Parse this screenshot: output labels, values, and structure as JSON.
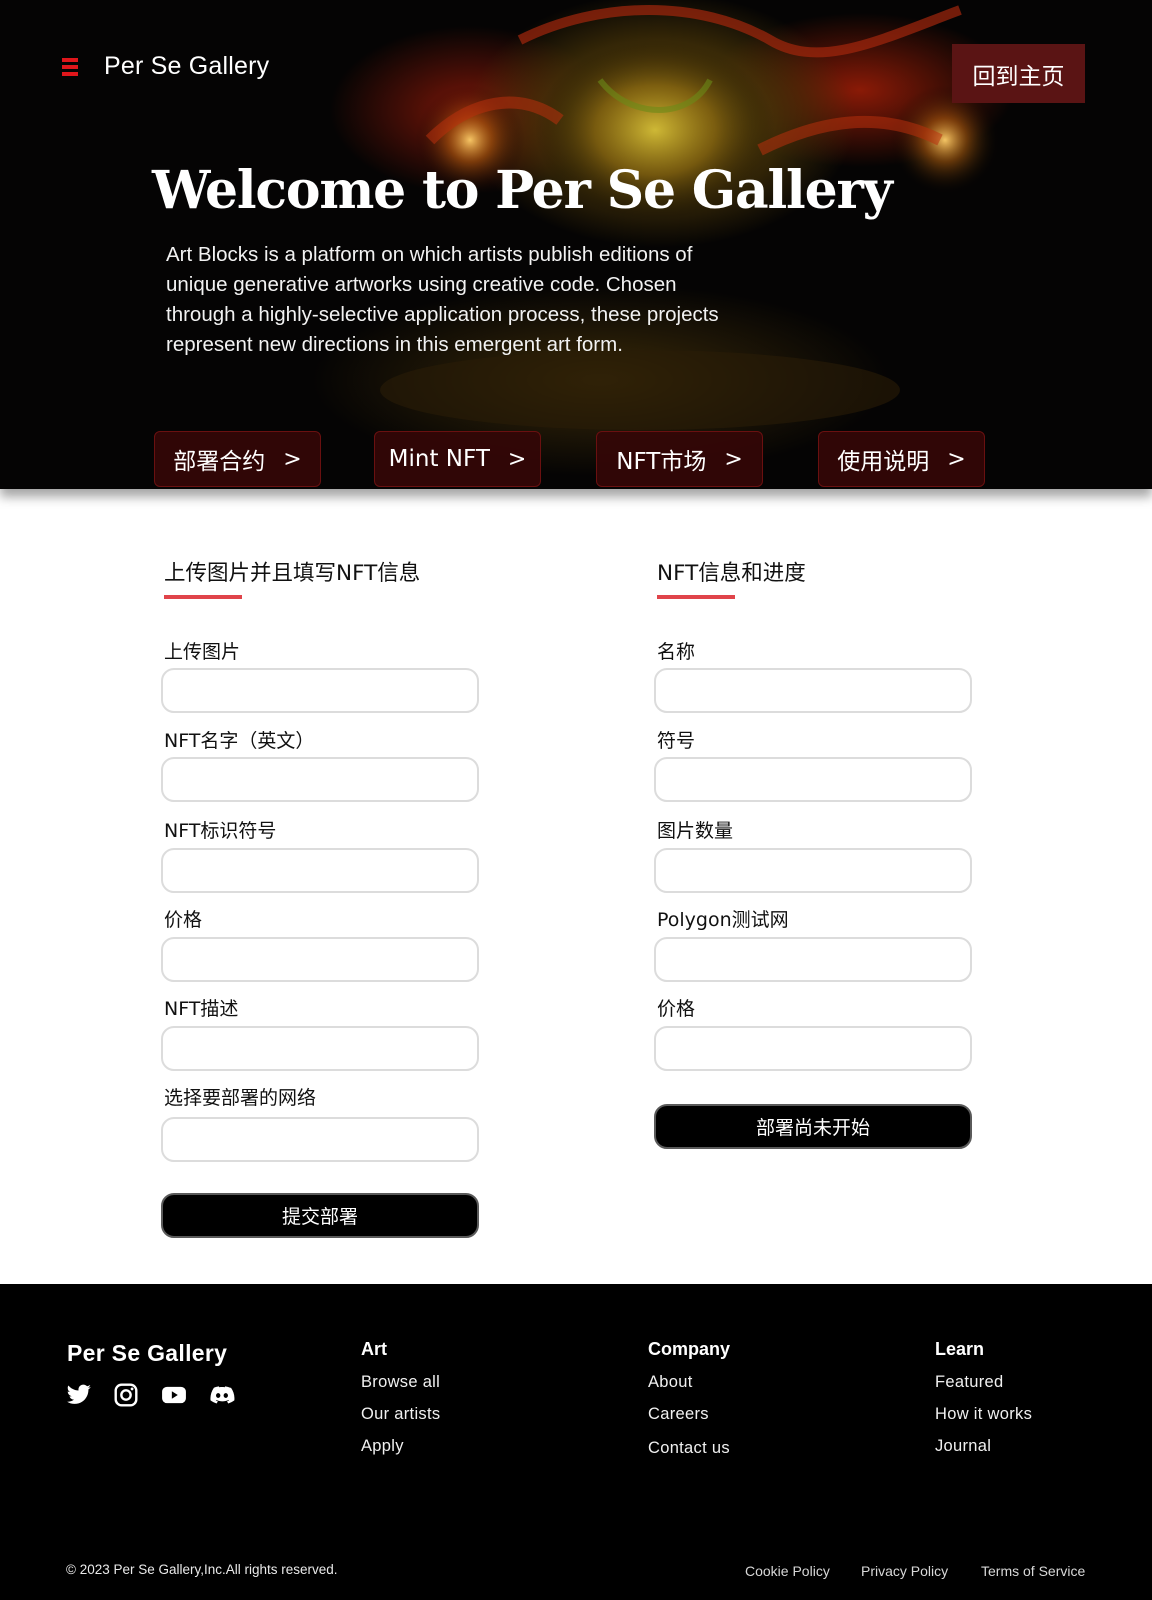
{
  "header": {
    "logo": "Per Se Gallery",
    "home_button": "回到主页"
  },
  "hero": {
    "title": "Welcome to Per Se Gallery",
    "description": "Art Blocks is a platform on which artists publish editions of unique generative artworks using creative code. Chosen through a highly-selective application process, these projects represent new directions in this emergent art form.",
    "buttons": [
      {
        "label": "部署合约"
      },
      {
        "label": "Mint NFT"
      },
      {
        "label": "NFT市场"
      },
      {
        "label": "使用说明"
      }
    ]
  },
  "upload_form": {
    "title": "上传图片并且填写NFT信息",
    "fields": [
      {
        "label": "上传图片",
        "value": ""
      },
      {
        "label": "NFT名字（英文）",
        "value": ""
      },
      {
        "label": "NFT标识符号",
        "value": ""
      },
      {
        "label": "价格",
        "value": ""
      },
      {
        "label": "NFT描述",
        "value": ""
      },
      {
        "label": "选择要部署的网络",
        "value": ""
      }
    ],
    "submit": "提交部署"
  },
  "info_panel": {
    "title": "NFT信息和进度",
    "fields": [
      {
        "label": "名称",
        "value": ""
      },
      {
        "label": "符号",
        "value": ""
      },
      {
        "label": "图片数量",
        "value": ""
      },
      {
        "label": "Polygon测试网",
        "value": ""
      },
      {
        "label": "价格",
        "value": ""
      }
    ],
    "status_button": "部署尚未开始"
  },
  "footer": {
    "brand": "Per Se Gallery",
    "social": [
      "twitter-icon",
      "instagram-icon",
      "youtube-icon",
      "discord-icon"
    ],
    "columns": [
      {
        "heading": "Art",
        "links": [
          "Browse all",
          "Our artists",
          "Apply"
        ]
      },
      {
        "heading": "Company",
        "links": [
          "About",
          "Careers",
          "Contact us"
        ]
      },
      {
        "heading": "Learn",
        "links": [
          "Featured",
          "How it works",
          "Journal"
        ]
      }
    ],
    "copyright": "© 2023 Per Se Gallery,Inc.All rights reserved.",
    "legal": [
      "Cookie Policy",
      "Privacy Policy",
      "Terms of Service"
    ]
  },
  "colors": {
    "accent_red": "#e0161b",
    "underline_red": "#e0444a",
    "home_button_bg": "#5a1414",
    "hero_button_bg": "#340606"
  }
}
